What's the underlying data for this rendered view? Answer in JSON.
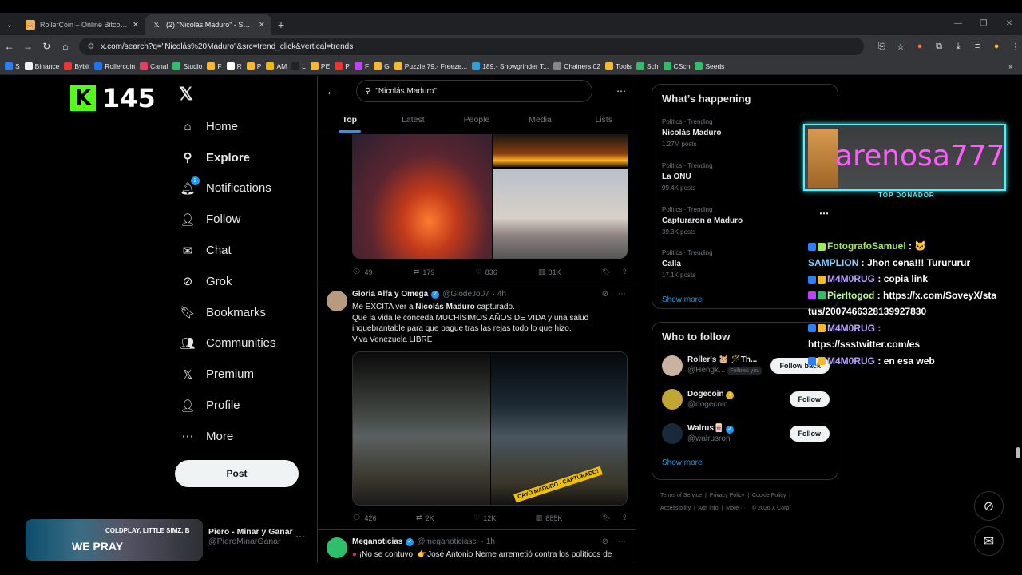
{
  "browser": {
    "tabs": [
      {
        "title": "RollerCoin – Online Bitcoin Mining",
        "active": false
      },
      {
        "title": "(2) \"Nicolás Maduro\" - Search / X",
        "active": true
      }
    ],
    "url": "x.com/search?q=\"Nicolás%20Maduro\"&src=trend_click&vertical=trends",
    "bookmarks": [
      "S",
      "Binance",
      "Bybit",
      "Rollercoin",
      "Canal",
      "Studio",
      "F",
      "R",
      "P",
      "AM",
      "L",
      "PE",
      "P",
      "F",
      "G",
      "Puzzle 79.- Freeze...",
      "189.- Snowgrinder T...",
      "Chainers 02",
      "Tools",
      "Sch",
      "CSch",
      "Seeds"
    ]
  },
  "overlay": {
    "kick_count": "145",
    "donor_name": "arenosa777",
    "donor_label": "TOP DONADOR",
    "chat": [
      {
        "user": "FotografoSamuel",
        "text": ""
      },
      {
        "user": "SAMPLION",
        "text": "Jhon cena!!! Turururur"
      },
      {
        "user": "M4M0RUG",
        "text": "copia link"
      },
      {
        "user": "PierItogod",
        "text": "https://x.com/SoveyX/status/2007466328139927830"
      },
      {
        "user": "M4M0RUG",
        "text": ""
      },
      {
        "user": "",
        "text": "https://ssstwitter.com/es"
      },
      {
        "user": "M4M0RUG",
        "text": "en esa web"
      }
    ]
  },
  "nav": {
    "items": [
      {
        "label": "Home",
        "icon": "home-icon"
      },
      {
        "label": "Explore",
        "icon": "search-icon"
      },
      {
        "label": "Notifications",
        "icon": "bell-icon",
        "badge": "2"
      },
      {
        "label": "Follow",
        "icon": "add-user-icon"
      },
      {
        "label": "Chat",
        "icon": "mail-icon"
      },
      {
        "label": "Grok",
        "icon": "grok-icon"
      },
      {
        "label": "Bookmarks",
        "icon": "bookmark-icon"
      },
      {
        "label": "Communities",
        "icon": "communities-icon"
      },
      {
        "label": "Premium",
        "icon": "x-icon"
      },
      {
        "label": "Profile",
        "icon": "profile-icon"
      },
      {
        "label": "More",
        "icon": "more-icon"
      }
    ],
    "post_label": "Post"
  },
  "account": {
    "banner_line1": "COLDPLAY, LITTLE SIMZ, B",
    "banner_line2": "WE PRAY",
    "name": "Piero - Minar y Ganar",
    "handle": "@PieroMinarGanar"
  },
  "search": {
    "query": "\"Nicolás Maduro\"",
    "tabs": [
      "Top",
      "Latest",
      "People",
      "Media",
      "Lists"
    ]
  },
  "tweets": [
    {
      "replies": "49",
      "reposts": "179",
      "likes": "836",
      "views": "81K"
    },
    {
      "name": "Gloria Alfa y Omega",
      "handle": "@GlodeJo07",
      "time": "· 4h",
      "line1_pre": "Me EXCITA ver a ",
      "line1_bold": "Nicolás Maduro",
      "line1_post": " capturado.",
      "line2": "Que la vida le conceda MUCHÍSIMOS AÑOS DE VIDA y una salud inquebrantable para que pague tras las rejas todo lo que hizo.",
      "line3": "Viva Venezuela LIBRE",
      "caption": "CAYO MADURO - CAPTURADO!",
      "replies": "426",
      "reposts": "2K",
      "likes": "12K",
      "views": "885K"
    },
    {
      "name": "Meganoticias",
      "handle": "@meganoticiascl",
      "time": "· 1h",
      "text": "¡No se contuvo! 👉José Antonio Neme arremetió contra los políticos de"
    }
  ],
  "trends": {
    "title": "What’s happening",
    "items": [
      {
        "category": "Politics · Trending",
        "name": "Nicolás Maduro",
        "posts": "1.27M posts"
      },
      {
        "category": "Politics · Trending",
        "name": "La ONU",
        "posts": "99.4K posts"
      },
      {
        "category": "Politics · Trending",
        "name": "Capturaron a Maduro",
        "posts": "39.3K posts"
      },
      {
        "category": "Politics · Trending",
        "name": "Calla",
        "posts": "17.1K posts"
      }
    ],
    "show_more": "Show more"
  },
  "who_to_follow": {
    "title": "Who to follow",
    "items": [
      {
        "name": "Roller's 🐹 🪄Th...",
        "handle": "@Hengk...",
        "follows_you": "Follows you",
        "button": "Follow back"
      },
      {
        "name": "Dogecoin",
        "handle": "@dogecoin",
        "button": "Follow"
      },
      {
        "name": "Walrus🀄",
        "handle": "@walrusron",
        "button": "Follow"
      }
    ],
    "show_more": "Show more"
  },
  "footer": {
    "links": [
      "Terms of Service",
      "Privacy Policy",
      "Cookie Policy",
      "Accessibility",
      "Ads info",
      "More ···",
      "© 2026 X Corp."
    ]
  },
  "colors": {
    "accent": "#1d9bf0",
    "kick": "#53fc18",
    "donor": "#ff5cff"
  }
}
